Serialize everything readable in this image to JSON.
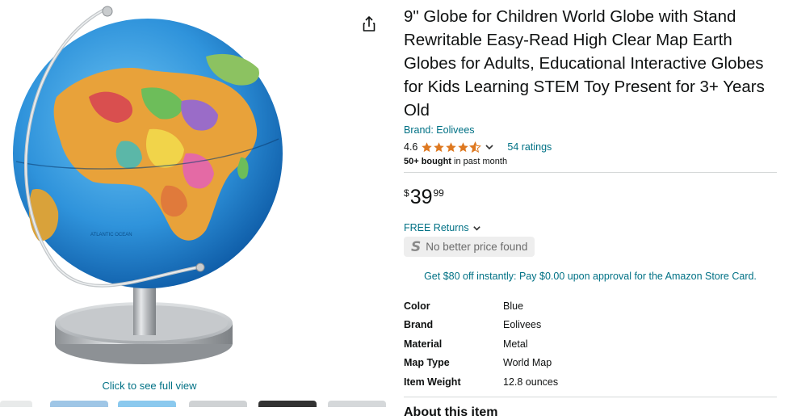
{
  "product": {
    "title": "9\" Globe for Children World Globe with Stand Rewritable Easy-Read High Clear Map Earth Globes for Adults, Educational Interactive Globes for Kids Learning STEM Toy Present for 3+ Years Old",
    "brand": "Brand: Eolivees",
    "rating_value": "4.6",
    "stars": 4.6,
    "ratings_count": "54 ratings",
    "bought_bold": "50+ bought",
    "bought_rest": " in past month",
    "price_symbol": "$",
    "price_whole": "39",
    "price_fraction": "99",
    "returns_label": "FREE Returns",
    "no_better_price": "No better price found",
    "card_offer": "Get $80 off instantly: Pay $0.00 upon approval for the Amazon Store Card.",
    "attributes": [
      {
        "key": "Color",
        "value": "Blue"
      },
      {
        "key": "Brand",
        "value": "Eolivees"
      },
      {
        "key": "Material",
        "value": "Metal"
      },
      {
        "key": "Map Type",
        "value": "World Map"
      },
      {
        "key": "Item Weight",
        "value": "12.8 ounces"
      }
    ],
    "about_heading": "About this item"
  },
  "gallery": {
    "full_view_link": "Click to see full view",
    "image_label": "ATLANTIC OCEAN"
  },
  "colors": {
    "link": "#007185",
    "star": "#de7921",
    "ocean": "#3a9ee0",
    "metal": "#b7babd"
  }
}
